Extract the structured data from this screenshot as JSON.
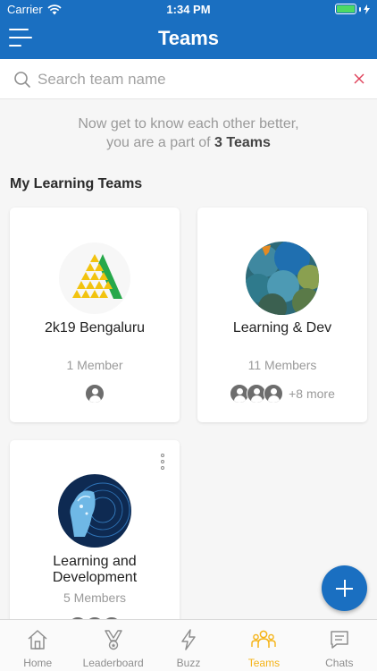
{
  "status_bar": {
    "carrier": "Carrier",
    "time": "1:34 PM"
  },
  "header": {
    "title": "Teams"
  },
  "search": {
    "placeholder": "Search team name",
    "value": ""
  },
  "intro": {
    "line1": "Now get to know each other better,",
    "line2_prefix": "you are a part of",
    "team_count": "3 Teams"
  },
  "section": {
    "title": "My Learning Teams"
  },
  "teams": [
    {
      "name": "2k19 Bengaluru",
      "members": "1 Member",
      "more": ""
    },
    {
      "name": "Learning & Dev",
      "members": "11 Members",
      "more": "+8 more"
    },
    {
      "name": "Learning and\nDevelopment",
      "members": "5 Members",
      "more": ""
    }
  ],
  "tabs": [
    {
      "label": "Home",
      "icon": "home-icon",
      "active": false
    },
    {
      "label": "Leaderboard",
      "icon": "trophy-icon",
      "active": false
    },
    {
      "label": "Buzz",
      "icon": "lightning-icon",
      "active": false
    },
    {
      "label": "Teams",
      "icon": "team-icon",
      "active": true
    },
    {
      "label": "Chats",
      "icon": "chat-icon",
      "active": false
    }
  ],
  "colors": {
    "brand_blue": "#1a6fc1",
    "active_tab": "#f5b316",
    "clear_red": "#e0425b"
  }
}
